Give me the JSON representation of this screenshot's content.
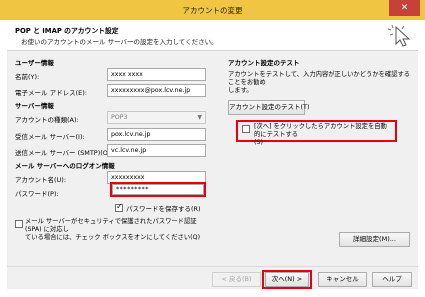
{
  "window": {
    "title": "アカウントの変更",
    "close_glyph": "✕"
  },
  "header": {
    "title": "POP と IMAP のアカウント設定",
    "subtitle": "お使いのアカウントのメール サーバーの設定を入力してください。"
  },
  "user_info": {
    "title": "ユーザー情報",
    "name_label": "名前(Y):",
    "name_value": "xxxx xxxx",
    "email_label": "電子メール アドレス(E):",
    "email_value": "xxxxxxxxx@pox.lcv.ne.jp"
  },
  "server_info": {
    "title": "サーバー情報",
    "account_type_label": "アカウントの種類(A):",
    "account_type_value": "POP3",
    "incoming_label": "受信メール サーバー(I):",
    "incoming_value": "pox.lcv.ne.jp",
    "outgoing_label": "送信メール サーバー (SMTP)(O):",
    "outgoing_value": "vc.lcv.ne.jp"
  },
  "logon_info": {
    "title": "メール サーバーへのログオン情報",
    "account_name_label": "アカウント名(U):",
    "account_name_value": "xxxxxxxxx",
    "password_label": "パスワード(P):",
    "password_value": "*********",
    "save_password_label": "パスワードを保存する(R)",
    "save_password_checked": true
  },
  "spa": {
    "line1": "メール サーバーがセキュリティで保護されたパスワード認証 (SPA) に対応し",
    "line2": "ている場合には、チェック ボックスをオンにしてください(Q)",
    "checked": false
  },
  "test": {
    "title": "アカウント設定のテスト",
    "description_line1": "アカウントをテストして、入力内容が正しいかどうかを確認することをお勧め",
    "description_line2": "します。",
    "button_label": "アカウント設定のテスト(T)",
    "auto_test_line1": "[次へ] をクリックしたらアカウント設定を自動的にテストする",
    "auto_test_line2": "(S)",
    "auto_test_checked": false
  },
  "buttons": {
    "advanced": "詳細設定(M)...",
    "back": "< 戻る(B)",
    "next": "次へ(N) >",
    "cancel": "キャンセル",
    "help": "ヘルプ"
  },
  "colors": {
    "title_bar": "#f0c541",
    "highlight": "#e60012",
    "close_button": "#c7403a"
  }
}
